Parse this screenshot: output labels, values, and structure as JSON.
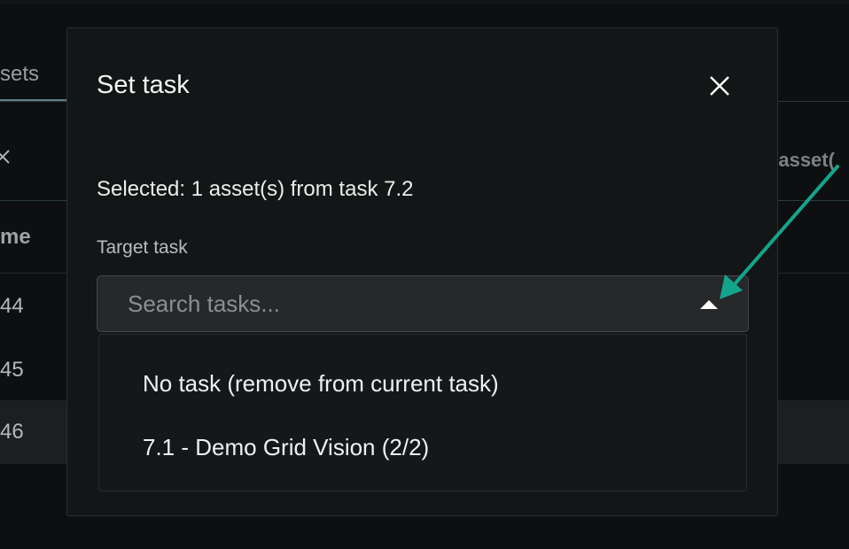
{
  "background": {
    "tab_label": "sets",
    "column_header": "me",
    "right_header": "e asset(",
    "rows": [
      "44",
      "45",
      "46"
    ]
  },
  "modal": {
    "title": "Set task",
    "selected_text": "Selected: 1 asset(s) from task 7.2",
    "target_label": "Target task",
    "search_placeholder": "Search tasks...",
    "options": [
      "No task (remove from current task)",
      "7.1 - Demo Grid Vision (2/2)"
    ]
  },
  "colors": {
    "annotation_arrow": "#14a48c",
    "modal_bg": "#131617"
  },
  "icons": {
    "close": "close-icon",
    "dropdown_toggle": "caret-up-icon"
  }
}
